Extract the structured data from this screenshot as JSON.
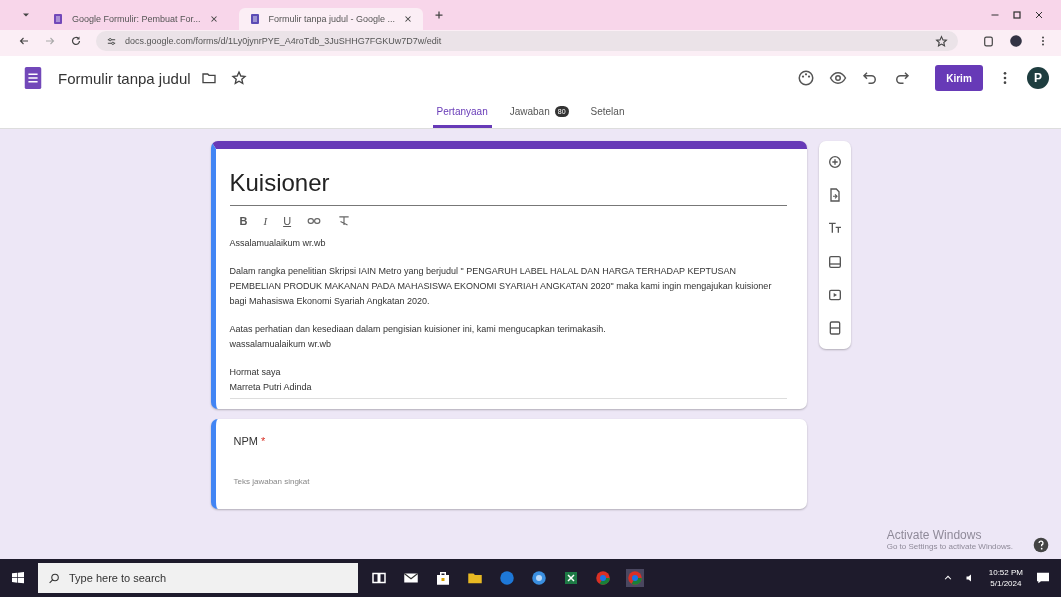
{
  "browser": {
    "tabs": [
      {
        "title": "Google Formulir: Pembuat For...",
        "selected": false
      },
      {
        "title": "Formulir tanpa judul - Google ...",
        "selected": true
      }
    ],
    "url": "docs.google.com/forms/d/1Ly0jynrPYE_A4roTdb_3JuSHHG7FGKUw7D7w/edit"
  },
  "header": {
    "title": "Formulir tanpa judul",
    "send_button": "Kirim",
    "avatar": "P"
  },
  "form_tabs": [
    {
      "label": "Pertanyaan",
      "selected": true
    },
    {
      "label": "Jawaban",
      "selected": false,
      "badge": "80"
    },
    {
      "label": "Setelan",
      "selected": false
    }
  ],
  "form": {
    "title": "Kuisioner",
    "format_buttons": [
      "B",
      "I",
      "U"
    ],
    "description": [
      [
        "Assalamualaikum wr.wb"
      ],
      [
        "Dalam rangka penelitian Skripsi IAIN Metro yang berjudul \" PENGARUH LABEL HALAL DAN HARGA TERHADAP KEPTUSAN PEMBELIAN PRODUK MAKANAN PADA MAHASISWA EKONOMI SYARIAH ANGKATAN 2020\" maka kami ingin mengajukan kuisioner bagi Mahasiswa Ekonomi Syariah Angkatan 2020."
      ],
      [
        "Aatas perhatian dan kesediaan dalam pengisian kuisioner ini, kami mengucapkan terimakasih.",
        "wassalamualaikum wr.wb"
      ],
      [
        "Hormat saya",
        "Marreta Putri Adinda"
      ]
    ]
  },
  "questions": [
    {
      "title": "NPM",
      "required": true,
      "required_mark": "*",
      "placeholder": "Teks jawaban singkat"
    }
  ],
  "activation": {
    "title": "Activate Windows",
    "subtitle": "Go to Settings to activate Windows."
  },
  "taskbar": {
    "search_placeholder": "Type here to search",
    "time": "10:52 PM",
    "date": "5/1/2024"
  }
}
